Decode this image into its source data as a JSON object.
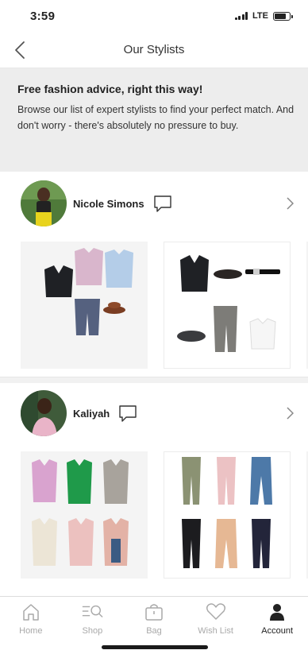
{
  "status_bar": {
    "time": "3:59",
    "network": "LTE",
    "battery_level": 0.75
  },
  "header": {
    "title": "Our Stylists",
    "back_icon": "chevron-left-icon"
  },
  "banner": {
    "title": "Free fashion advice, right this way!",
    "text": "Browse our list of expert stylists to find your perfect match. And don't worry - there's absolutely no pressure to buy."
  },
  "stylists": [
    {
      "name": "Nicole Simons",
      "chat_icon": "chat-bubble-icon",
      "chevron_icon": "chevron-right-icon"
    },
    {
      "name": "Kaliyah",
      "chat_icon": "chat-bubble-icon",
      "chevron_icon": "chevron-right-icon"
    }
  ],
  "tab_bar": {
    "items": [
      {
        "label": "Home",
        "icon": "home-icon",
        "active": false
      },
      {
        "label": "Shop",
        "icon": "search-list-icon",
        "active": false
      },
      {
        "label": "Bag",
        "icon": "bag-icon",
        "active": false
      },
      {
        "label": "Wish List",
        "icon": "heart-icon",
        "active": false
      },
      {
        "label": "Account",
        "icon": "person-icon",
        "active": true
      }
    ]
  },
  "colors": {
    "banner_bg": "#ededed",
    "inactive_tab": "#a9a9a9",
    "active_tab": "#222222"
  }
}
